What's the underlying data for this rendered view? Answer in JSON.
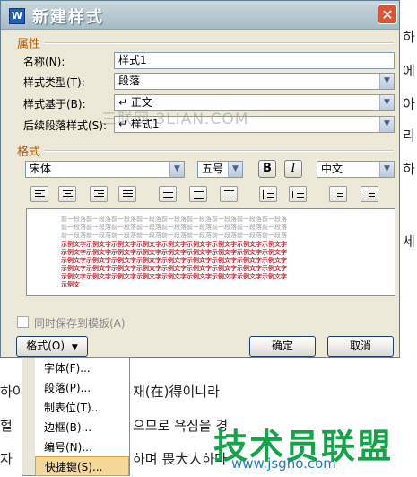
{
  "dialog": {
    "title": "新建样式",
    "app_icon": "W",
    "close_icon": "close-icon"
  },
  "properties": {
    "section_title": "属性",
    "name_label": "名称(N):",
    "name_value": "样式1",
    "type_label": "样式类型(T):",
    "type_value": "段落",
    "based_on_label": "样式基于(B):",
    "based_on_value": "↵ 正文",
    "next_label": "后续段落样式(S):",
    "next_value": "↵ 样式1"
  },
  "watermark": "三联网 3LIAN.COM",
  "format": {
    "section_title": "格式",
    "font_value": "宋体",
    "size_value": "五号",
    "bold_label": "B",
    "italic_label": "I",
    "lang_value": "中文"
  },
  "preview": {
    "grey_lines": [
      "前一段落前一段落前一段落前一段落前一段落前一段落前一段落前一段落前一段落",
      "前一段落前一段落前一段落前一段落前一段落前一段落前一段落前一段落前一段落",
      "前一段落前一段落前一段落前一段落前一段落前一段落前一段落前一段落前一段落"
    ],
    "red_lines": [
      "示例文字示例文字示例文字示例文字示例文字示例文字示例文字示例文字示例文字",
      "示例文字示例文字示例文字示例文字示例文字示例文字示例文字示例文字示例文字",
      "示例文字示例文字示例文字示例文字示例文字示例文字示例文字示例文字示例文字",
      "示例文字示例文字示例文字示例文字示例文字示例文字示例文字示例文字示例文字",
      "示例文字示例文字示例文字示例文字示例文字示例文字示例文字示例文字示例文字",
      "示例文"
    ]
  },
  "options": {
    "save_to_template_label": "同时保存到模板(A)"
  },
  "buttons": {
    "format_label": "格式(O)",
    "ok_label": "确定",
    "cancel_label": "取消"
  },
  "menu": {
    "items": [
      {
        "label": "字体(F)..."
      },
      {
        "label": "段落(P)..."
      },
      {
        "label": "制表位(T)..."
      },
      {
        "label": "边框(B)..."
      },
      {
        "label": "编号(N)..."
      },
      {
        "label": "快捷键(S)..."
      }
    ]
  },
  "background": {
    "lines": [
      {
        "text": "하"
      },
      {
        "text": "에"
      },
      {
        "text": "아"
      },
      {
        "text": "헬"
      },
      {
        "text": "자"
      },
      {
        "text": "리"
      },
      {
        "text": "자"
      },
      {
        "text": "정"
      },
      {
        "text": "세"
      },
      {
        "text": "하"
      },
      {
        "text": "하이"
      },
      {
        "text": "재(在)得이니라"
      },
      {
        "text": "헐"
      },
      {
        "text": "으므로 욕심을 경"
      },
      {
        "text": "자"
      },
      {
        "text": "하며 畏大人하다"
      }
    ]
  },
  "site_logo": {
    "text": "技术员联盟",
    "url": "www.jsgho.com"
  }
}
